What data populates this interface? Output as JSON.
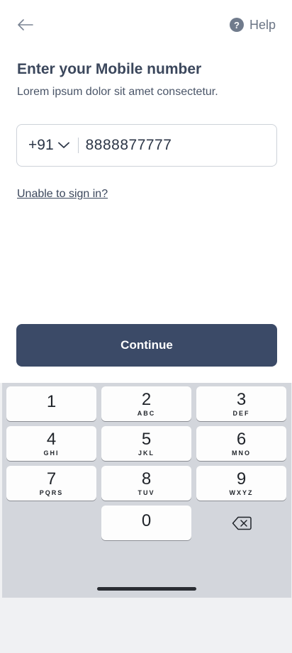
{
  "header": {
    "help_label": "Help",
    "back_icon": "arrow-left-icon",
    "help_icon": "question-circle-icon",
    "help_icon_glyph": "?"
  },
  "main": {
    "title": "Enter your Mobile number",
    "subtitle": "Lorem ipsum dolor sit amet consectetur.",
    "phone": {
      "country_code": "+91",
      "number": "8888877777",
      "dropdown_icon": "chevron-down-icon"
    },
    "unable_link": "Unable to sign in?",
    "continue_label": "Continue"
  },
  "keypad": {
    "keys": [
      {
        "digit": "1",
        "letters": ""
      },
      {
        "digit": "2",
        "letters": "ABC"
      },
      {
        "digit": "3",
        "letters": "DEF"
      },
      {
        "digit": "4",
        "letters": "GHI"
      },
      {
        "digit": "5",
        "letters": "JKL"
      },
      {
        "digit": "6",
        "letters": "MNO"
      },
      {
        "digit": "7",
        "letters": "PQRS"
      },
      {
        "digit": "8",
        "letters": "TUV"
      },
      {
        "digit": "9",
        "letters": "WXYZ"
      },
      {
        "digit": "0",
        "letters": ""
      }
    ],
    "backspace_icon": "backspace-icon"
  },
  "colors": {
    "primary": "#3b4a67",
    "text": "#3b475c",
    "keypad_bg": "#d3d6dc"
  }
}
